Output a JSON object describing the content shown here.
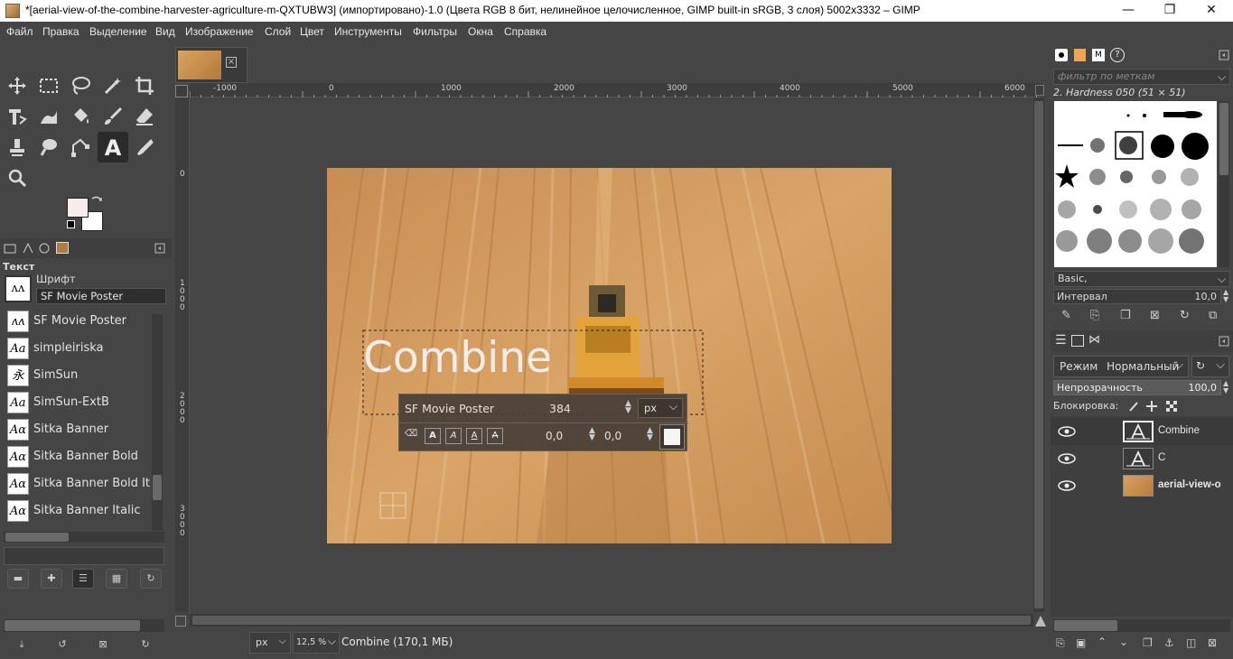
{
  "window": {
    "title": "*[aerial-view-of-the-combine-harvester-agriculture-m-QXTUBW3] (импортировано)-1.0 (Цвета RGB 8 бит, нелинейное целочисленное, GIMP built-in sRGB, 3 слоя) 5002x3332 – GIMP",
    "minimize": "—",
    "maximize": "❐",
    "close": "✕"
  },
  "menu": [
    "Файл",
    "Правка",
    "Выделение",
    "Вид",
    "Изображение",
    "Слой",
    "Цвет",
    "Инструменты",
    "Фильтры",
    "Окна",
    "Справка"
  ],
  "tools": [
    "move-icon",
    "rect-select-icon",
    "lasso-icon",
    "fuzzy-select-icon",
    "crop-icon",
    "unified-transform-icon",
    "warp-icon",
    "bucket-fill-icon",
    "paintbrush-icon",
    "eraser-icon",
    "clone-icon",
    "smudge-icon",
    "paths-icon",
    "text-tool-icon",
    "color-picker-icon",
    "zoom-icon"
  ],
  "font_panel": {
    "header": "Текст",
    "font_label": "Шрифт",
    "font_value": "SF Movie Poster",
    "fonts": [
      {
        "name": "SF Movie Poster",
        "glyph": "ʌʌ"
      },
      {
        "name": "simpleiriska",
        "glyph": "Aa"
      },
      {
        "name": "SimSun",
        "glyph": "永"
      },
      {
        "name": "SimSun-ExtB",
        "glyph": "Aa"
      },
      {
        "name": "Sitka Banner",
        "glyph": "Aα"
      },
      {
        "name": "Sitka Banner Bold",
        "glyph": "Aα"
      },
      {
        "name": "Sitka Banner Bold It",
        "glyph": "Aα"
      },
      {
        "name": "Sitka Banner Italic",
        "glyph": "Aα"
      }
    ]
  },
  "canvas": {
    "ruler_h": [
      "-1000",
      "0",
      "1000",
      "2000",
      "3000",
      "4000",
      "5000",
      "6000"
    ],
    "ruler_v": [
      "0",
      "1000",
      "2000",
      "3000"
    ],
    "text_layer_text": "Combine",
    "text_toolbar": {
      "font": "SF Movie Poster",
      "size": "384",
      "unit": "px",
      "baseline": "0,0",
      "kerning": "0,0"
    }
  },
  "status": {
    "unit": "px",
    "zoom": "12,5 %",
    "info": "Combine (170,1 МБ)"
  },
  "brushes": {
    "filter_placeholder": "фильтр по меткам",
    "current": "2. Hardness 050 (51 × 51)",
    "preset": "Basic,",
    "spacing_label": "Интервал",
    "spacing_value": "10,0"
  },
  "layers": {
    "mode_label": "Режим",
    "mode_value": "Нормальный",
    "opacity_label": "Непрозрачность",
    "opacity_value": "100,0",
    "lock_label": "Блокировка:",
    "items": [
      {
        "name": "Combine",
        "type": "text"
      },
      {
        "name": "C",
        "type": "text"
      },
      {
        "name": "aerial-view-o",
        "type": "image"
      }
    ]
  },
  "colors": {
    "fg": "#f7ecec",
    "bg": "#ffffff",
    "accent": "#e0c28a"
  }
}
